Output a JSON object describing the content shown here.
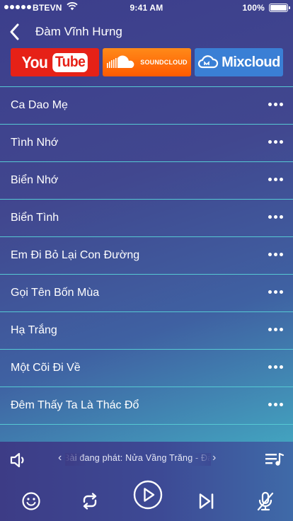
{
  "status_bar": {
    "carrier": "BTEVN",
    "time": "9:41 AM",
    "battery": "100%"
  },
  "header": {
    "title": "Đàm Vĩnh Hưng"
  },
  "services": {
    "youtube_you": "You",
    "youtube_tube": "Tube",
    "soundcloud": "SOUNDCLOUD",
    "mixcloud": "Mixcloud"
  },
  "songs": [
    {
      "title": "Ca Dao Mẹ"
    },
    {
      "title": "Tình Nhớ"
    },
    {
      "title": "Biển Nhớ"
    },
    {
      "title": "Biển Tình"
    },
    {
      "title": "Em Đi Bỏ Lại Con Đường"
    },
    {
      "title": "Gọi Tên Bốn Mùa"
    },
    {
      "title": "Hạ Trắng"
    },
    {
      "title": "Một Cõi Đi Về"
    },
    {
      "title": "Đêm Thấy Ta Là Thác Đổ"
    }
  ],
  "player": {
    "now_playing": "Bài đang phát: Nửa Vầng Trăng - Đàm Vĩnh Hưng",
    "prev_label": "‹",
    "next_label": "›"
  },
  "colors": {
    "divider": "#56c9d3",
    "youtube": "#e62117",
    "soundcloud": "#ff6a00",
    "mixcloud": "#3a7fd5"
  },
  "icons": {
    "back": "chevron-left-icon",
    "more": "ellipsis-icon",
    "volume": "speaker-icon",
    "playlist": "playlist-icon",
    "emoji": "smiley-icon",
    "repeat": "repeat-icon",
    "play": "play-icon",
    "next": "skip-next-icon",
    "mic": "mic-off-icon"
  }
}
